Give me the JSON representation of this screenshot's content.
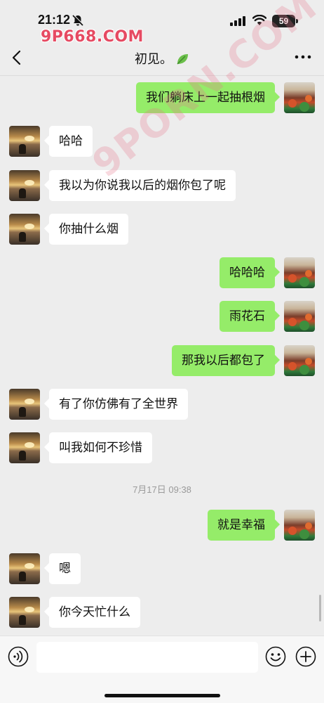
{
  "status_bar": {
    "time": "21:12",
    "battery": "59",
    "icons": [
      "bell-slash-icon",
      "signal-icon",
      "wifi-icon",
      "battery-icon"
    ]
  },
  "watermark": {
    "top_text": "9P668.COM",
    "diagonal_text": "9PORN.COM"
  },
  "nav": {
    "title": "初见。",
    "back_icon": "chevron-left-icon",
    "more_icon": "more-icon",
    "title_icon": "leaf-icon"
  },
  "messages": [
    {
      "side": "right",
      "text": "我们躺床上一起抽根烟",
      "avatar": "crowd"
    },
    {
      "side": "left",
      "text": "哈哈",
      "avatar": "sunset"
    },
    {
      "side": "left",
      "text": "我以为你说我以后的烟你包了呢",
      "avatar": "sunset"
    },
    {
      "side": "left",
      "text": "你抽什么烟",
      "avatar": "sunset"
    },
    {
      "side": "right",
      "text": "哈哈哈",
      "avatar": "crowd"
    },
    {
      "side": "right",
      "text": "雨花石",
      "avatar": "crowd"
    },
    {
      "side": "right",
      "text": "那我以后都包了",
      "avatar": "crowd"
    },
    {
      "side": "left",
      "text": "有了你仿佛有了全世界",
      "avatar": "sunset"
    },
    {
      "side": "left",
      "text": "叫我如何不珍惜",
      "avatar": "sunset"
    },
    {
      "side": "right",
      "text": "就是幸福",
      "avatar": "crowd"
    },
    {
      "side": "left",
      "text": "嗯",
      "avatar": "sunset"
    },
    {
      "side": "left",
      "text": "你今天忙什么",
      "avatar": "sunset"
    }
  ],
  "timestamp": "7月17日 09:38",
  "input_bar": {
    "placeholder": "",
    "voice_icon": "voice-icon",
    "emoji_icon": "emoji-icon",
    "plus_icon": "plus-icon"
  },
  "colors": {
    "background": "#ededed",
    "bubble_sent": "#95ec69",
    "bubble_received": "#ffffff",
    "watermark": "#e64a62"
  }
}
